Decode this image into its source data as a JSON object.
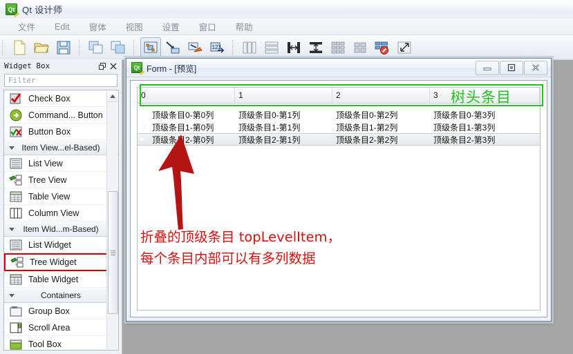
{
  "window": {
    "app_title": "Qt 设计师",
    "app_icon": "qt-logo-icon"
  },
  "menubar": {
    "items": [
      {
        "label": "文件"
      },
      {
        "label": "Edit"
      },
      {
        "label": "窗体"
      },
      {
        "label": "视图"
      },
      {
        "label": "设置"
      },
      {
        "label": "窗口"
      },
      {
        "label": "帮助"
      }
    ]
  },
  "toolbar": {
    "groups": [
      {
        "buttons": [
          {
            "name": "new-file-icon"
          },
          {
            "name": "open-file-icon"
          },
          {
            "name": "save-file-icon"
          }
        ]
      },
      {
        "buttons": [
          {
            "name": "undo-icon"
          },
          {
            "name": "redo-icon"
          }
        ]
      },
      {
        "buttons": [
          {
            "name": "edit-widgets-icon",
            "active": true
          },
          {
            "name": "edit-signals-slots-icon"
          },
          {
            "name": "edit-buddies-icon"
          },
          {
            "name": "edit-tab-order-icon"
          }
        ]
      },
      {
        "buttons": [
          {
            "name": "layout-horizontally-icon"
          },
          {
            "name": "layout-vertically-icon"
          },
          {
            "name": "layout-splitter-horizontal-icon"
          },
          {
            "name": "layout-splitter-vertical-icon"
          },
          {
            "name": "layout-grid-icon"
          },
          {
            "name": "layout-form-icon"
          },
          {
            "name": "break-layout-icon"
          },
          {
            "name": "adjust-size-icon"
          }
        ]
      }
    ]
  },
  "widget_box": {
    "title": "Widget Box",
    "float_button": "float-icon",
    "close_button": "close-icon",
    "filter_placeholder": "Filter",
    "items": [
      {
        "type": "item",
        "label": "Check Box",
        "icon": "check-box-icon"
      },
      {
        "type": "item",
        "label": "Command... Button",
        "icon": "command-link-button-icon"
      },
      {
        "type": "item",
        "label": "Button Box",
        "icon": "button-box-icon"
      },
      {
        "type": "category",
        "label": "Item View...el-Based)"
      },
      {
        "type": "item",
        "label": "List View",
        "icon": "list-view-icon"
      },
      {
        "type": "item",
        "label": "Tree View",
        "icon": "tree-view-icon"
      },
      {
        "type": "item",
        "label": "Table View",
        "icon": "table-view-icon"
      },
      {
        "type": "item",
        "label": "Column View",
        "icon": "column-view-icon"
      },
      {
        "type": "category",
        "label": "Item Wid...m-Based)"
      },
      {
        "type": "item",
        "label": "List Widget",
        "icon": "list-widget-icon"
      },
      {
        "type": "item",
        "label": "Tree Widget",
        "icon": "tree-widget-icon",
        "selected": true
      },
      {
        "type": "item",
        "label": "Table Widget",
        "icon": "table-widget-icon"
      },
      {
        "type": "category",
        "label": "Containers"
      },
      {
        "type": "item",
        "label": "Group Box",
        "icon": "group-box-icon"
      },
      {
        "type": "item",
        "label": "Scroll Area",
        "icon": "scroll-area-icon"
      },
      {
        "type": "item",
        "label": "Tool Box",
        "icon": "tool-box-icon"
      }
    ]
  },
  "form_window": {
    "title": "Form - [预览]",
    "icon": "qt-logo-icon",
    "minimize_label": "minimize-icon",
    "restore_label": "restore-icon",
    "close_label": "close-icon"
  },
  "tree_widget": {
    "headers": [
      "0",
      "1",
      "2",
      "3"
    ],
    "rows": [
      {
        "expandable": false,
        "cells": [
          "顶级条目0-第0列",
          "顶级条目0-第1列",
          "顶级条目0-第2列",
          "顶级条目0-第3列"
        ]
      },
      {
        "expandable": true,
        "cells": [
          "顶级条目1-第0列",
          "顶级条目1-第1列",
          "顶级条目1-第2列",
          "顶级条目1-第3列"
        ]
      },
      {
        "expandable": true,
        "selected": true,
        "cells": [
          "顶级条目2-第0列",
          "顶级条目2-第1列",
          "顶级条目2-第2列",
          "顶级条目2-第3列"
        ]
      }
    ]
  },
  "annotations": {
    "header_label": "树头条目",
    "header_color": "#22c022",
    "body_line1": "折叠的顶级条目 topLevelItem，",
    "body_line2": "每个条目内部可以有多列数据",
    "body_color": "#d01414",
    "arrow_color": "#b41414",
    "arrow_name": "red-up-arrow-annotation"
  }
}
